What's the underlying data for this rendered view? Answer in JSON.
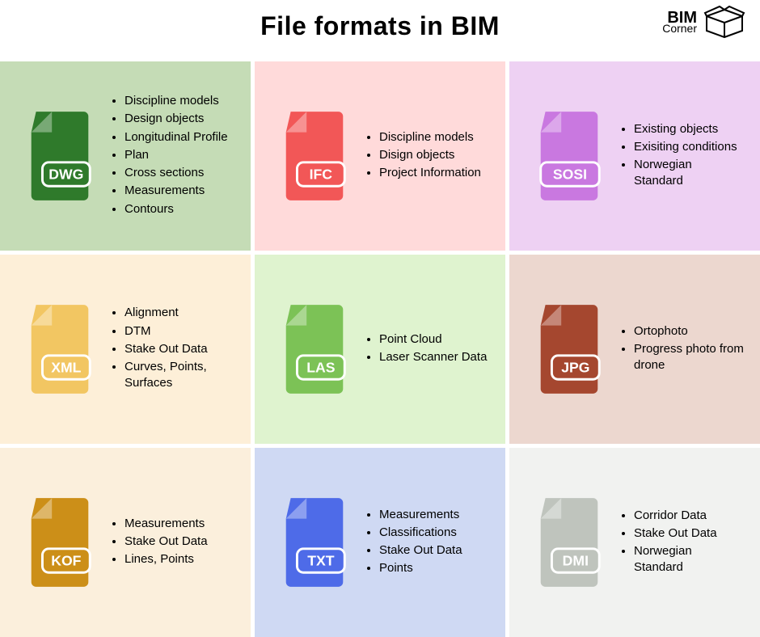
{
  "title": "File formats in BIM",
  "logo": {
    "line1": "BIM",
    "line2": "Corner"
  },
  "cards": [
    {
      "ext": "DWG",
      "bg": "#c5dcb6",
      "fg": "#2f7a2b",
      "items": [
        "Discipline models",
        "Design objects",
        "Longitudinal Profile",
        "Plan",
        "Cross sections",
        "Measurements",
        "Contours"
      ]
    },
    {
      "ext": "IFC",
      "bg": "#ffdada",
      "fg": "#f25757",
      "items": [
        "Discipline models",
        "Disign objects",
        "Project Information"
      ]
    },
    {
      "ext": "SOSI",
      "bg": "#eed1f3",
      "fg": "#c978e0",
      "items": [
        "Existing objects",
        "Exisiting conditions",
        "Norwegian Standard"
      ]
    },
    {
      "ext": "XML",
      "bg": "#fdefd8",
      "fg": "#f2c662",
      "items": [
        "Alignment",
        "DTM",
        "Stake Out Data",
        "Curves, Points, Surfaces"
      ]
    },
    {
      "ext": "LAS",
      "bg": "#dff3cf",
      "fg": "#7cc256",
      "items": [
        "Point Cloud",
        "Laser Scanner Data"
      ]
    },
    {
      "ext": "JPG",
      "bg": "#ecd7cf",
      "fg": "#a5472f",
      "items": [
        "Ortophoto",
        "Progress photo from drone"
      ]
    },
    {
      "ext": "KOF",
      "bg": "#fbefdc",
      "fg": "#cc8f18",
      "items": [
        "Measurements",
        "Stake Out Data",
        "Lines, Points"
      ]
    },
    {
      "ext": "TXT",
      "bg": "#cfd9f3",
      "fg": "#4e6be8",
      "items": [
        "Measurements",
        "Classifications",
        "Stake Out Data",
        "Points"
      ]
    },
    {
      "ext": "DMI",
      "bg": "#f1f2f0",
      "fg": "#bfc4bd",
      "items": [
        "Corridor Data",
        "Stake Out Data",
        "Norwegian Standard"
      ]
    }
  ]
}
